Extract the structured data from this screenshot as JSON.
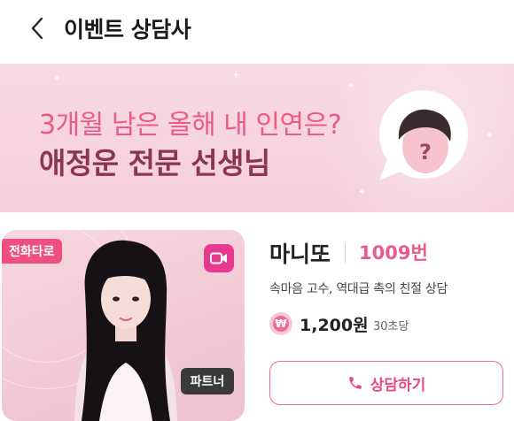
{
  "header": {
    "title": "이벤트 상담사"
  },
  "banner": {
    "line1": "3개월 남은 올해 내 인연은?",
    "line2": "애정운 전문 선생님",
    "bubble_icon": "question-person-icon"
  },
  "counselor": {
    "type_tag": "전화타로",
    "partner_tag": "파트너",
    "name": "마니또",
    "number": "1009번",
    "description": "속마음 고수, 역대급 촉의 친절 상담",
    "coin_symbol": "₩",
    "price": "1,200원",
    "price_unit": "30초당",
    "consult_label": "상담하기"
  },
  "colors": {
    "accent_pink": "#ec5a86",
    "banner_bg": "#f6d3df",
    "title_dark_rose": "#8a3653",
    "video_magenta": "#e53a8e"
  }
}
